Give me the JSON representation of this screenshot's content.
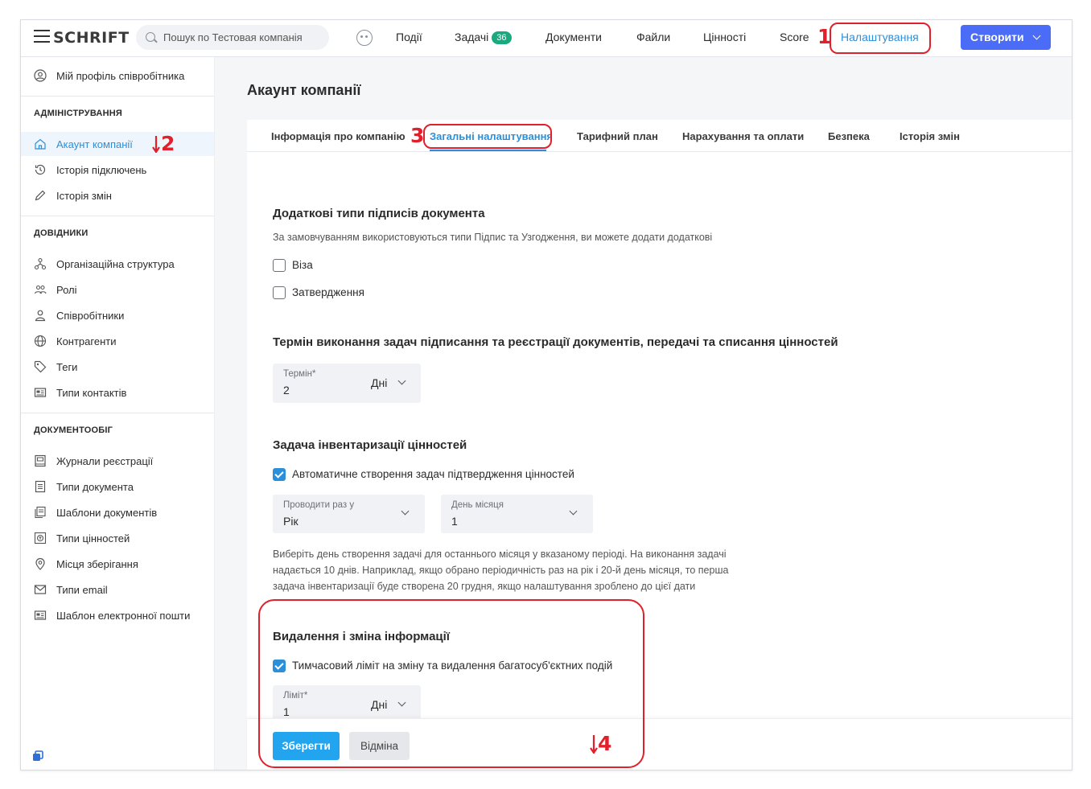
{
  "app": {
    "logo": "SCHRIFT"
  },
  "search": {
    "placeholder": "Пошук по Тестовая компанія"
  },
  "nav": {
    "items": [
      {
        "label": "Події"
      },
      {
        "label": "Задачі",
        "badge": "36"
      },
      {
        "label": "Документи"
      },
      {
        "label": "Файли"
      },
      {
        "label": "Цінності"
      },
      {
        "label": "Score"
      },
      {
        "label": "Налаштування"
      }
    ],
    "create_label": "Створити"
  },
  "sidebar": {
    "profile": "Мій профіль співробітника",
    "sections": [
      {
        "heading": "АДМІНІСТРУВАННЯ",
        "items": [
          {
            "label": "Акаунт компанії"
          },
          {
            "label": "Історія підключень"
          },
          {
            "label": "Історія змін"
          }
        ]
      },
      {
        "heading": "ДОВІДНИКИ",
        "items": [
          {
            "label": "Організаційна структура"
          },
          {
            "label": "Ролі"
          },
          {
            "label": "Співробітники"
          },
          {
            "label": "Контрагенти"
          },
          {
            "label": "Теги"
          },
          {
            "label": "Типи контактів"
          }
        ]
      },
      {
        "heading": "ДОКУМЕНТООБІГ",
        "items": [
          {
            "label": "Журнали реєстрації"
          },
          {
            "label": "Типи документа"
          },
          {
            "label": "Шаблони документів"
          },
          {
            "label": "Типи цінностей"
          },
          {
            "label": "Місця зберігання"
          },
          {
            "label": "Типи email"
          },
          {
            "label": "Шаблон електронної пошти"
          }
        ]
      }
    ]
  },
  "page": {
    "title": "Акаунт компанії"
  },
  "tabs": [
    {
      "label": "Інформація про компанію"
    },
    {
      "label": "Загальні налаштування"
    },
    {
      "label": "Тарифний план"
    },
    {
      "label": "Нарахування та оплати"
    },
    {
      "label": "Безпека"
    },
    {
      "label": "Історія змін"
    }
  ],
  "signature_types": {
    "title": "Додаткові типи підписів документа",
    "description": "За замовчуванням використовуються типи Підпис та Узгодження, ви можете додати додаткові",
    "options": [
      {
        "label": "Віза",
        "checked": false
      },
      {
        "label": "Затвердження",
        "checked": false
      }
    ]
  },
  "deadline": {
    "title": "Термін виконання задач підписання та реєстрації документів, передачі та списання цінностей",
    "field_label": "Термін*",
    "value": "2",
    "unit": "Дні"
  },
  "inventory": {
    "title": "Задача інвентаризації цінностей",
    "auto_label": "Автоматичне створення задач підтвердження цінностей",
    "auto_checked": true,
    "period_label": "Проводити раз у",
    "period_value": "Рік",
    "day_label": "День місяця",
    "day_value": "1",
    "hint_line1": "Виберіть день створення задачі для останнього місяця у вказаному періоді. На виконання задачі",
    "hint_line2": "надається 10 днів. Наприклад, якщо обрано періодичність раз на рік і 20-й день місяця, то перша",
    "hint_line3": "задача інвентаризації буде створена 20 грудня, якщо налаштування зроблено до цієї дати"
  },
  "deletion": {
    "title": "Видалення і зміна інформації",
    "limit_label_check": "Тимчасовий ліміт на зміну та видалення багатосуб'єктних подій",
    "limit_checked": true,
    "field_label": "Ліміт*",
    "value": "1",
    "unit": "Дні"
  },
  "footer": {
    "save_label": "Зберегти",
    "cancel_label": "Відміна"
  },
  "annotations": {
    "n1": "1",
    "n2": "2",
    "n3": "3",
    "n4": "4"
  },
  "colors": {
    "accent": "#2d8fd8",
    "primary_button": "#4a6cf7",
    "save_button": "#22a5ee",
    "badge": "#1aa87f",
    "annotation": "#e0202a"
  }
}
